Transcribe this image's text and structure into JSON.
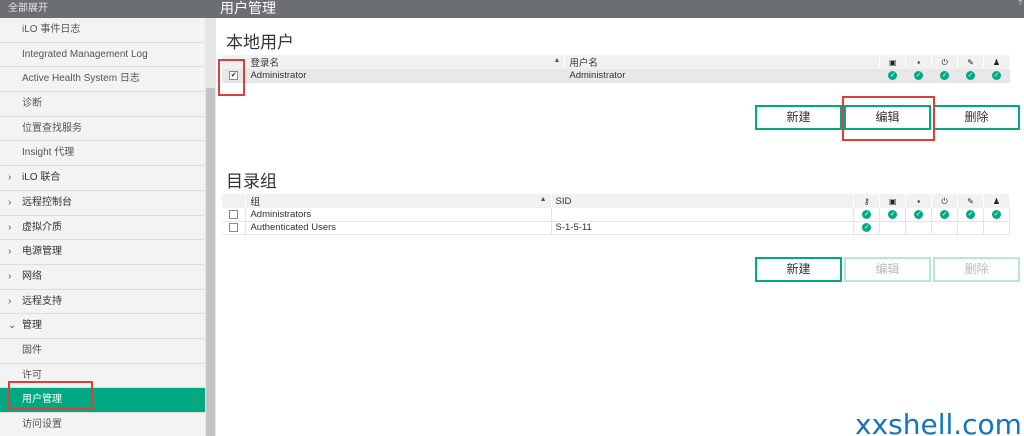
{
  "sidebar": {
    "header": "全部展开",
    "items": [
      {
        "label": "iLO 事件日志",
        "type": "child"
      },
      {
        "label": "Integrated Management Log",
        "type": "child"
      },
      {
        "label": "Active Health System 日志",
        "type": "child"
      },
      {
        "label": "诊断",
        "type": "child"
      },
      {
        "label": "位置查找服务",
        "type": "child"
      },
      {
        "label": "Insight 代理",
        "type": "child"
      },
      {
        "label": "iLO 联合",
        "type": "parent",
        "chevron": "›"
      },
      {
        "label": "远程控制台",
        "type": "parent",
        "chevron": "›"
      },
      {
        "label": "虚拟介质",
        "type": "parent",
        "chevron": "›"
      },
      {
        "label": "电源管理",
        "type": "parent",
        "chevron": "›"
      },
      {
        "label": "网络",
        "type": "parent",
        "chevron": "›"
      },
      {
        "label": "远程支持",
        "type": "parent",
        "chevron": "›"
      },
      {
        "label": "管理",
        "type": "parent",
        "chevron": "⌄"
      },
      {
        "label": "固件",
        "type": "child"
      },
      {
        "label": "许可",
        "type": "child"
      },
      {
        "label": "用户管理",
        "type": "child",
        "active": true
      },
      {
        "label": "访问设置",
        "type": "child"
      }
    ]
  },
  "topbar": {
    "title": "用户管理",
    "help": "?"
  },
  "local_users": {
    "title": "本地用户",
    "columns": {
      "login": "登录名",
      "username": "用户名"
    },
    "header_icons": [
      "image-icon",
      "save-icon",
      "power-icon",
      "wrench-icon",
      "user-icon"
    ],
    "rows": [
      {
        "checked": true,
        "login": "Administrator",
        "username": "Administrator",
        "perms": [
          true,
          true,
          true,
          true,
          true
        ]
      }
    ],
    "buttons": {
      "new": "新建",
      "edit": "编辑",
      "delete": "删除"
    }
  },
  "directory_groups": {
    "title": "目录组",
    "columns": {
      "group": "组",
      "sid": "SID"
    },
    "header_icons": [
      "key-icon",
      "image-icon",
      "save-icon",
      "power-icon",
      "wrench-icon",
      "user-icon"
    ],
    "rows": [
      {
        "checked": false,
        "group": "Administrators",
        "sid": "",
        "perms": [
          true,
          true,
          true,
          true,
          true,
          true
        ]
      },
      {
        "checked": false,
        "group": "Authenticated Users",
        "sid": "S-1-5-11",
        "perms": [
          true,
          false,
          false,
          false,
          false,
          false
        ]
      }
    ],
    "buttons": {
      "new": "新建",
      "edit": "编辑",
      "delete": "删除"
    }
  },
  "watermark": "xxshell.com",
  "colors": {
    "accent": "#01a982",
    "highlight": "#d9403a",
    "topbar": "#6b6e72"
  }
}
